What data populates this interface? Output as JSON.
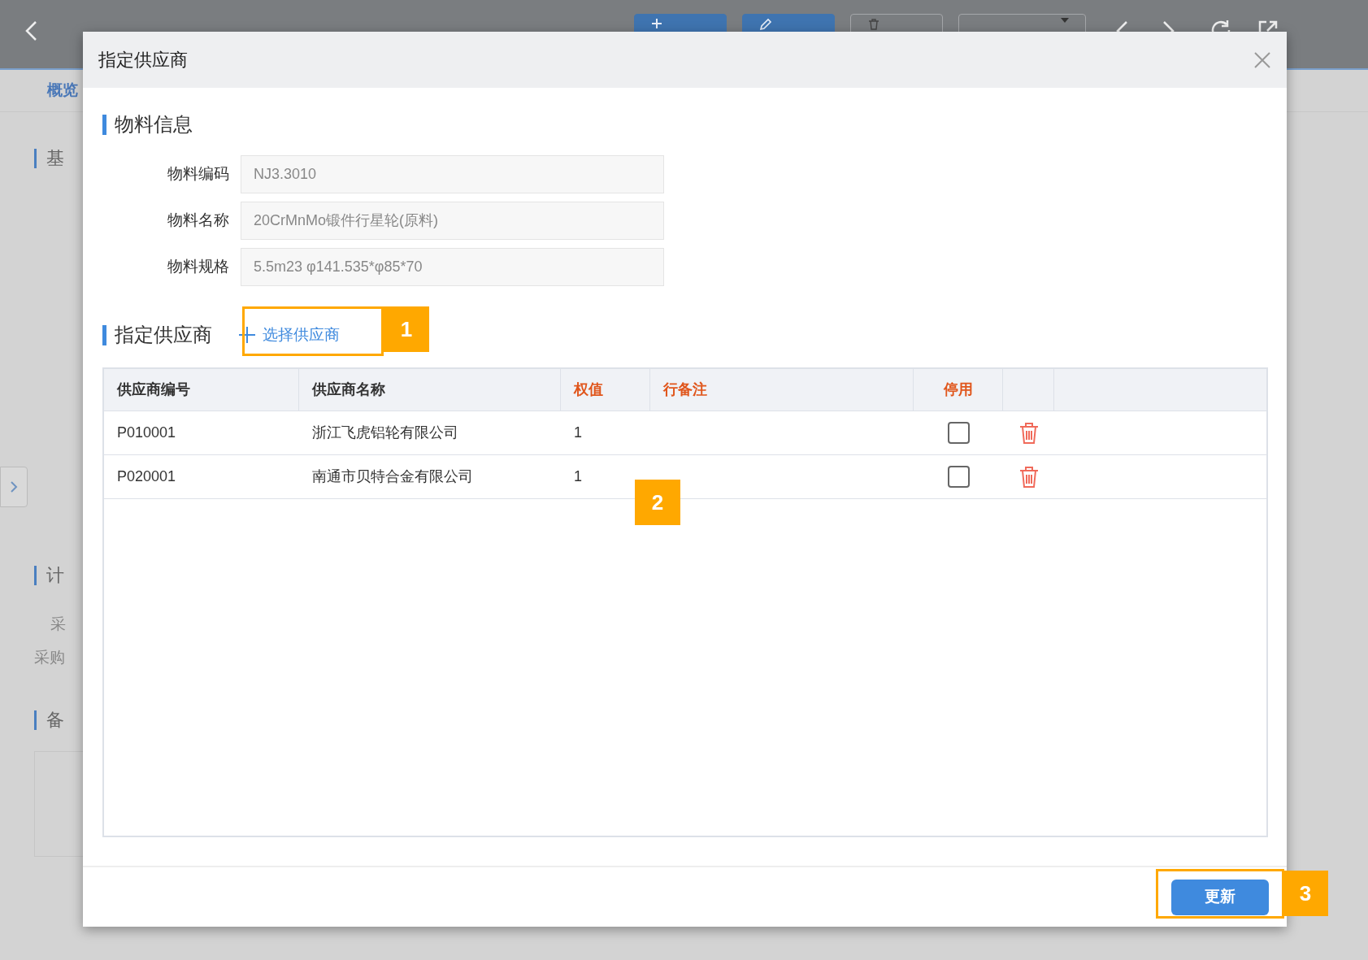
{
  "page": {
    "toolbar": [
      {
        "kind": "add",
        "primary": true
      },
      {
        "kind": "edit",
        "primary": true
      },
      {
        "kind": "delete",
        "primary": false
      },
      {
        "kind": "more",
        "primary": false
      }
    ],
    "tabs": [
      {
        "label": "概览",
        "selected": true
      }
    ],
    "sections": [
      {
        "title": "基",
        "kind": "heading"
      },
      {
        "title": "计",
        "kind": "heading"
      },
      {
        "title": "采",
        "kind": "label"
      },
      {
        "title": "采购",
        "kind": "label"
      },
      {
        "title": "备",
        "kind": "heading"
      }
    ]
  },
  "dialog": {
    "title": "指定供应商",
    "material_section": "物料信息",
    "fields": [
      {
        "label": "物料编码",
        "value": "NJ3.3010"
      },
      {
        "label": "物料名称",
        "value": "20CrMnMo锻件行星轮(原料)"
      },
      {
        "label": "物料规格",
        "value": "5.5m23 φ141.535*φ85*70"
      }
    ],
    "supplier_section": "指定供应商",
    "select_link": "选择供应商",
    "table": {
      "columns": [
        {
          "label": "供应商编号",
          "highlight": false
        },
        {
          "label": "供应商名称",
          "highlight": false
        },
        {
          "label": "权值",
          "highlight": true
        },
        {
          "label": "行备注",
          "highlight": true
        },
        {
          "label": "停用",
          "highlight": true
        }
      ],
      "rows": [
        {
          "code": "P010001",
          "name": "浙江飞虎铝轮有限公司",
          "weight": "1",
          "note_disabled": false
        },
        {
          "code": "P020001",
          "name": "南通市贝特合金有限公司",
          "weight": "1",
          "note_disabled": false
        }
      ]
    },
    "update_button": "更新"
  },
  "annotations": [
    {
      "label": "1",
      "boxed": true
    },
    {
      "label": "2",
      "boxed": false
    },
    {
      "label": "3",
      "boxed": true
    }
  ]
}
